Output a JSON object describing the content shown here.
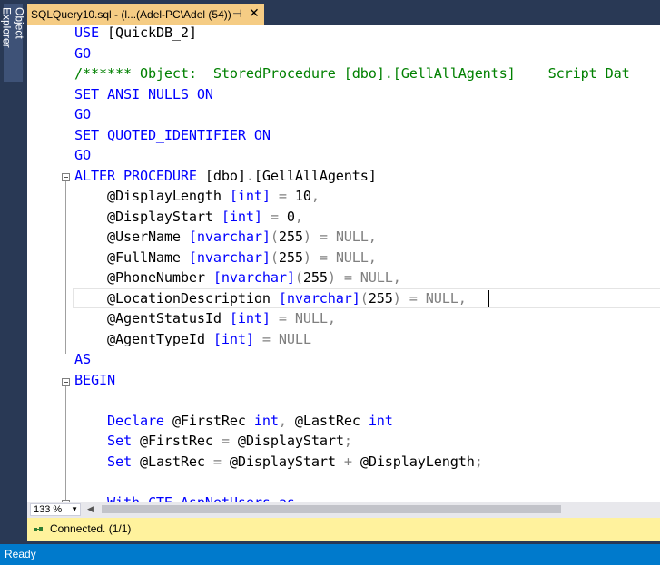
{
  "left_dock": {
    "object_explorer_label": "Object Explorer"
  },
  "document_tab": {
    "title": "SQLQuery10.sql - (l...(Adel-PC\\Adel (54))",
    "pin_icon": "pin-icon",
    "close_icon": "close-icon"
  },
  "editor": {
    "lines": [
      [
        [
          "kw",
          "USE "
        ],
        [
          "bk",
          "[QuickDB_2]"
        ]
      ],
      [
        [
          "kw",
          "GO"
        ]
      ],
      [
        [
          "cm",
          "/****** Object:  StoredProcedure [dbo].[GellAllAgents]    Script Dat"
        ]
      ],
      [
        [
          "kw",
          "SET ANSI_NULLS ON"
        ]
      ],
      [
        [
          "kw",
          "GO"
        ]
      ],
      [
        [
          "kw",
          "SET QUOTED_IDENTIFIER ON"
        ]
      ],
      [
        [
          "kw",
          "GO"
        ]
      ],
      [
        [
          "kw",
          "ALTER PROCEDURE "
        ],
        [
          "bk",
          "[dbo]"
        ],
        [
          "gy",
          "."
        ],
        [
          "bk",
          "[GellAllAgents]"
        ]
      ],
      [
        [
          "bk",
          "    @DisplayLength "
        ],
        [
          "kw",
          "[int]"
        ],
        [
          "gy",
          " = "
        ],
        [
          "bk",
          "10"
        ],
        [
          "gy",
          ","
        ]
      ],
      [
        [
          "bk",
          "    @DisplayStart "
        ],
        [
          "kw",
          "[int]"
        ],
        [
          "gy",
          " = "
        ],
        [
          "bk",
          "0"
        ],
        [
          "gy",
          ","
        ]
      ],
      [
        [
          "bk",
          "    @UserName "
        ],
        [
          "kw",
          "[nvarchar]"
        ],
        [
          "gy",
          "("
        ],
        [
          "bk",
          "255"
        ],
        [
          "gy",
          ") = NULL,"
        ]
      ],
      [
        [
          "bk",
          "    @FullName "
        ],
        [
          "kw",
          "[nvarchar]"
        ],
        [
          "gy",
          "("
        ],
        [
          "bk",
          "255"
        ],
        [
          "gy",
          ") = NULL,"
        ]
      ],
      [
        [
          "bk",
          "    @PhoneNumber "
        ],
        [
          "kw",
          "[nvarchar]"
        ],
        [
          "gy",
          "("
        ],
        [
          "bk",
          "255"
        ],
        [
          "gy",
          ") = NULL,"
        ]
      ],
      [
        [
          "bk",
          "    @LocationDescription "
        ],
        [
          "kw",
          "[nvarchar]"
        ],
        [
          "gy",
          "("
        ],
        [
          "bk",
          "255"
        ],
        [
          "gy",
          ") = NULL,"
        ]
      ],
      [
        [
          "bk",
          "    @AgentStatusId "
        ],
        [
          "kw",
          "[int]"
        ],
        [
          "gy",
          " = NULL,"
        ]
      ],
      [
        [
          "bk",
          "    @AgentTypeId "
        ],
        [
          "kw",
          "[int]"
        ],
        [
          "gy",
          " = NULL"
        ]
      ],
      [
        [
          "kw",
          "AS"
        ]
      ],
      [
        [
          "kw",
          "BEGIN"
        ]
      ],
      [],
      [
        [
          "kw",
          "    Declare "
        ],
        [
          "bk",
          "@FirstRec "
        ],
        [
          "kw",
          "int"
        ],
        [
          "gy",
          ", "
        ],
        [
          "bk",
          "@LastRec "
        ],
        [
          "kw",
          "int"
        ]
      ],
      [
        [
          "kw",
          "    Set "
        ],
        [
          "bk",
          "@FirstRec "
        ],
        [
          "gy",
          "= "
        ],
        [
          "bk",
          "@DisplayStart"
        ],
        [
          "gy",
          ";"
        ]
      ],
      [
        [
          "kw",
          "    Set "
        ],
        [
          "bk",
          "@LastRec "
        ],
        [
          "gy",
          "= "
        ],
        [
          "bk",
          "@DisplayStart "
        ],
        [
          "gy",
          "+ "
        ],
        [
          "bk",
          "@DisplayLength"
        ],
        [
          "gy",
          ";"
        ]
      ],
      [],
      [
        [
          "kw",
          "    With CTE_AspNetUsers as"
        ]
      ]
    ]
  },
  "zoom": {
    "value": "133 %"
  },
  "connection": {
    "text": "Connected. (1/1)",
    "icon": "connected-icon"
  },
  "status": {
    "text": "Ready"
  },
  "colors": {
    "keyword": "#0000ff",
    "comment": "#008000",
    "operator": "#808080",
    "tab_active": "#f5cc84",
    "status_bar": "#007acc",
    "connection_bar": "#fff29d"
  }
}
